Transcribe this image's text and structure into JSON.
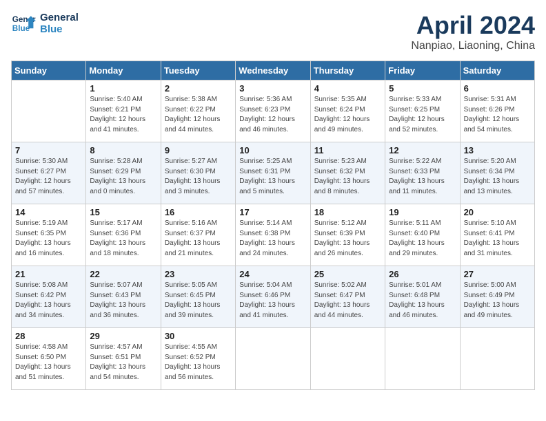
{
  "header": {
    "logo_line1": "General",
    "logo_line2": "Blue",
    "month": "April 2024",
    "location": "Nanpiao, Liaoning, China"
  },
  "weekdays": [
    "Sunday",
    "Monday",
    "Tuesday",
    "Wednesday",
    "Thursday",
    "Friday",
    "Saturday"
  ],
  "weeks": [
    [
      {
        "day": "",
        "sunrise": "",
        "sunset": "",
        "daylight": ""
      },
      {
        "day": "1",
        "sunrise": "5:40 AM",
        "sunset": "6:21 PM",
        "daylight": "12 hours and 41 minutes."
      },
      {
        "day": "2",
        "sunrise": "5:38 AM",
        "sunset": "6:22 PM",
        "daylight": "12 hours and 44 minutes."
      },
      {
        "day": "3",
        "sunrise": "5:36 AM",
        "sunset": "6:23 PM",
        "daylight": "12 hours and 46 minutes."
      },
      {
        "day": "4",
        "sunrise": "5:35 AM",
        "sunset": "6:24 PM",
        "daylight": "12 hours and 49 minutes."
      },
      {
        "day": "5",
        "sunrise": "5:33 AM",
        "sunset": "6:25 PM",
        "daylight": "12 hours and 52 minutes."
      },
      {
        "day": "6",
        "sunrise": "5:31 AM",
        "sunset": "6:26 PM",
        "daylight": "12 hours and 54 minutes."
      }
    ],
    [
      {
        "day": "7",
        "sunrise": "5:30 AM",
        "sunset": "6:27 PM",
        "daylight": "12 hours and 57 minutes."
      },
      {
        "day": "8",
        "sunrise": "5:28 AM",
        "sunset": "6:29 PM",
        "daylight": "13 hours and 0 minutes."
      },
      {
        "day": "9",
        "sunrise": "5:27 AM",
        "sunset": "6:30 PM",
        "daylight": "13 hours and 3 minutes."
      },
      {
        "day": "10",
        "sunrise": "5:25 AM",
        "sunset": "6:31 PM",
        "daylight": "13 hours and 5 minutes."
      },
      {
        "day": "11",
        "sunrise": "5:23 AM",
        "sunset": "6:32 PM",
        "daylight": "13 hours and 8 minutes."
      },
      {
        "day": "12",
        "sunrise": "5:22 AM",
        "sunset": "6:33 PM",
        "daylight": "13 hours and 11 minutes."
      },
      {
        "day": "13",
        "sunrise": "5:20 AM",
        "sunset": "6:34 PM",
        "daylight": "13 hours and 13 minutes."
      }
    ],
    [
      {
        "day": "14",
        "sunrise": "5:19 AM",
        "sunset": "6:35 PM",
        "daylight": "13 hours and 16 minutes."
      },
      {
        "day": "15",
        "sunrise": "5:17 AM",
        "sunset": "6:36 PM",
        "daylight": "13 hours and 18 minutes."
      },
      {
        "day": "16",
        "sunrise": "5:16 AM",
        "sunset": "6:37 PM",
        "daylight": "13 hours and 21 minutes."
      },
      {
        "day": "17",
        "sunrise": "5:14 AM",
        "sunset": "6:38 PM",
        "daylight": "13 hours and 24 minutes."
      },
      {
        "day": "18",
        "sunrise": "5:12 AM",
        "sunset": "6:39 PM",
        "daylight": "13 hours and 26 minutes."
      },
      {
        "day": "19",
        "sunrise": "5:11 AM",
        "sunset": "6:40 PM",
        "daylight": "13 hours and 29 minutes."
      },
      {
        "day": "20",
        "sunrise": "5:10 AM",
        "sunset": "6:41 PM",
        "daylight": "13 hours and 31 minutes."
      }
    ],
    [
      {
        "day": "21",
        "sunrise": "5:08 AM",
        "sunset": "6:42 PM",
        "daylight": "13 hours and 34 minutes."
      },
      {
        "day": "22",
        "sunrise": "5:07 AM",
        "sunset": "6:43 PM",
        "daylight": "13 hours and 36 minutes."
      },
      {
        "day": "23",
        "sunrise": "5:05 AM",
        "sunset": "6:45 PM",
        "daylight": "13 hours and 39 minutes."
      },
      {
        "day": "24",
        "sunrise": "5:04 AM",
        "sunset": "6:46 PM",
        "daylight": "13 hours and 41 minutes."
      },
      {
        "day": "25",
        "sunrise": "5:02 AM",
        "sunset": "6:47 PM",
        "daylight": "13 hours and 44 minutes."
      },
      {
        "day": "26",
        "sunrise": "5:01 AM",
        "sunset": "6:48 PM",
        "daylight": "13 hours and 46 minutes."
      },
      {
        "day": "27",
        "sunrise": "5:00 AM",
        "sunset": "6:49 PM",
        "daylight": "13 hours and 49 minutes."
      }
    ],
    [
      {
        "day": "28",
        "sunrise": "4:58 AM",
        "sunset": "6:50 PM",
        "daylight": "13 hours and 51 minutes."
      },
      {
        "day": "29",
        "sunrise": "4:57 AM",
        "sunset": "6:51 PM",
        "daylight": "13 hours and 54 minutes."
      },
      {
        "day": "30",
        "sunrise": "4:55 AM",
        "sunset": "6:52 PM",
        "daylight": "13 hours and 56 minutes."
      },
      {
        "day": "",
        "sunrise": "",
        "sunset": "",
        "daylight": ""
      },
      {
        "day": "",
        "sunrise": "",
        "sunset": "",
        "daylight": ""
      },
      {
        "day": "",
        "sunrise": "",
        "sunset": "",
        "daylight": ""
      },
      {
        "day": "",
        "sunrise": "",
        "sunset": "",
        "daylight": ""
      }
    ]
  ]
}
